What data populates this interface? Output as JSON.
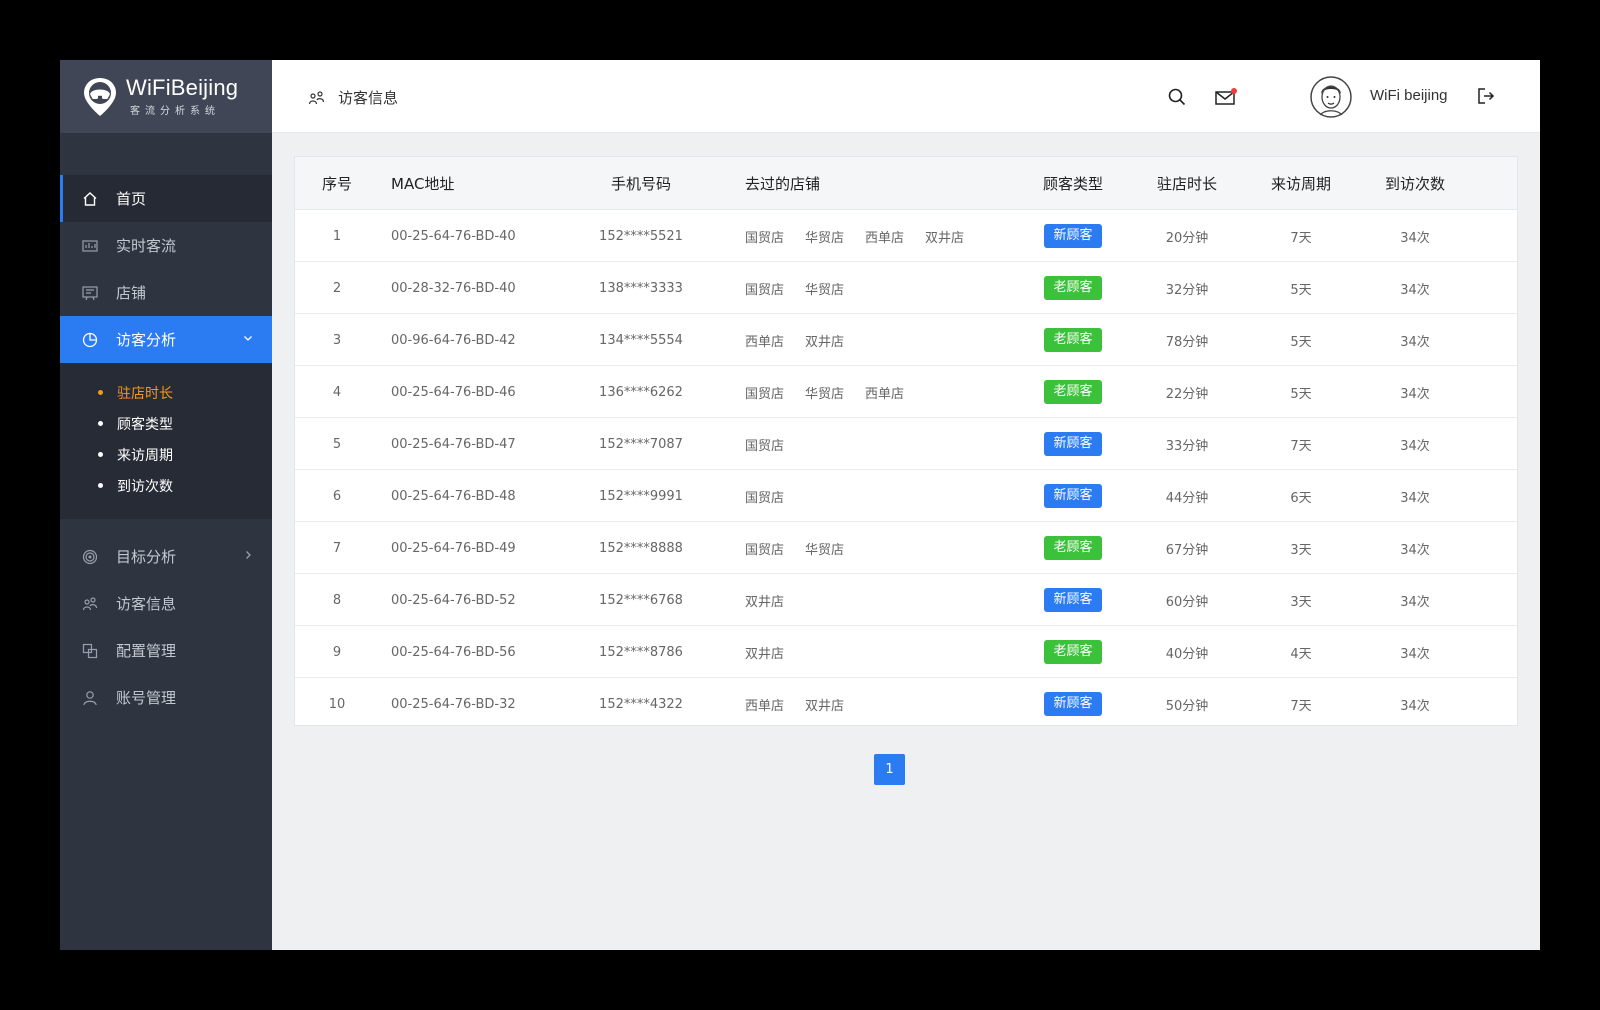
{
  "brand": {
    "name": "WiFiBeijing",
    "subtitle": "客流分析系统"
  },
  "sidebar": {
    "items": [
      {
        "label": "首页",
        "icon": "home-icon"
      },
      {
        "label": "实时客流",
        "icon": "realtime-flow-icon"
      },
      {
        "label": "店铺",
        "icon": "store-icon"
      },
      {
        "label": "访客分析",
        "icon": "pie-chart-icon"
      },
      {
        "label": "目标分析",
        "icon": "target-icon"
      },
      {
        "label": "访客信息",
        "icon": "visitors-icon"
      },
      {
        "label": "配置管理",
        "icon": "config-icon"
      },
      {
        "label": "账号管理",
        "icon": "account-icon"
      }
    ],
    "sub_items": [
      {
        "label": "驻店时长"
      },
      {
        "label": "顾客类型"
      },
      {
        "label": "来访周期"
      },
      {
        "label": "到访次数"
      }
    ]
  },
  "header": {
    "breadcrumb": "访客信息",
    "username": "WiFi beijing"
  },
  "table": {
    "headers": {
      "idx": "序号",
      "mac": "MAC地址",
      "phone": "手机号码",
      "shops": "去过的店铺",
      "type": "顾客类型",
      "duration": "驻店时长",
      "cycle": "来访周期",
      "count": "到访次数"
    },
    "rows": [
      {
        "idx": "1",
        "mac": "00-25-64-76-BD-40",
        "phone": "152****5521",
        "shops": [
          "国贸店",
          "华贸店",
          "西单店",
          "双井店"
        ],
        "type": "新顾客",
        "duration": "20分钟",
        "cycle": "7天",
        "count": "34次"
      },
      {
        "idx": "2",
        "mac": "00-28-32-76-BD-40",
        "phone": "138****3333",
        "shops": [
          "国贸店",
          "华贸店"
        ],
        "type": "老顾客",
        "duration": "32分钟",
        "cycle": "5天",
        "count": "34次"
      },
      {
        "idx": "3",
        "mac": "00-96-64-76-BD-42",
        "phone": "134****5554",
        "shops": [
          "西单店",
          "双井店"
        ],
        "type": "老顾客",
        "duration": "78分钟",
        "cycle": "5天",
        "count": "34次"
      },
      {
        "idx": "4",
        "mac": "00-25-64-76-BD-46",
        "phone": "136****6262",
        "shops": [
          "国贸店",
          "华贸店",
          "西单店"
        ],
        "type": "老顾客",
        "duration": "22分钟",
        "cycle": "5天",
        "count": "34次"
      },
      {
        "idx": "5",
        "mac": "00-25-64-76-BD-47",
        "phone": "152****7087",
        "shops": [
          "国贸店"
        ],
        "type": "新顾客",
        "duration": "33分钟",
        "cycle": "7天",
        "count": "34次"
      },
      {
        "idx": "6",
        "mac": "00-25-64-76-BD-48",
        "phone": "152****9991",
        "shops": [
          "国贸店"
        ],
        "type": "新顾客",
        "duration": "44分钟",
        "cycle": "6天",
        "count": "34次"
      },
      {
        "idx": "7",
        "mac": "00-25-64-76-BD-49",
        "phone": "152****8888",
        "shops": [
          "国贸店",
          "华贸店"
        ],
        "type": "老顾客",
        "duration": "67分钟",
        "cycle": "3天",
        "count": "34次"
      },
      {
        "idx": "8",
        "mac": "00-25-64-76-BD-52",
        "phone": "152****6768",
        "shops": [
          "双井店"
        ],
        "type": "新顾客",
        "duration": "60分钟",
        "cycle": "3天",
        "count": "34次"
      },
      {
        "idx": "9",
        "mac": "00-25-64-76-BD-56",
        "phone": "152****8786",
        "shops": [
          "双井店"
        ],
        "type": "老顾客",
        "duration": "40分钟",
        "cycle": "4天",
        "count": "34次"
      },
      {
        "idx": "10",
        "mac": "00-25-64-76-BD-32",
        "phone": "152****4322",
        "shops": [
          "西单店",
          "双井店"
        ],
        "type": "新顾客",
        "duration": "50分钟",
        "cycle": "7天",
        "count": "34次"
      }
    ]
  },
  "pagination": {
    "current": "1"
  },
  "colors": {
    "primary": "#2b7bf3",
    "new_badge": "#2b7bf3",
    "old_badge": "#3cc13b",
    "sidebar_bg": "#2f3441",
    "sub_active": "#f39a1a"
  }
}
